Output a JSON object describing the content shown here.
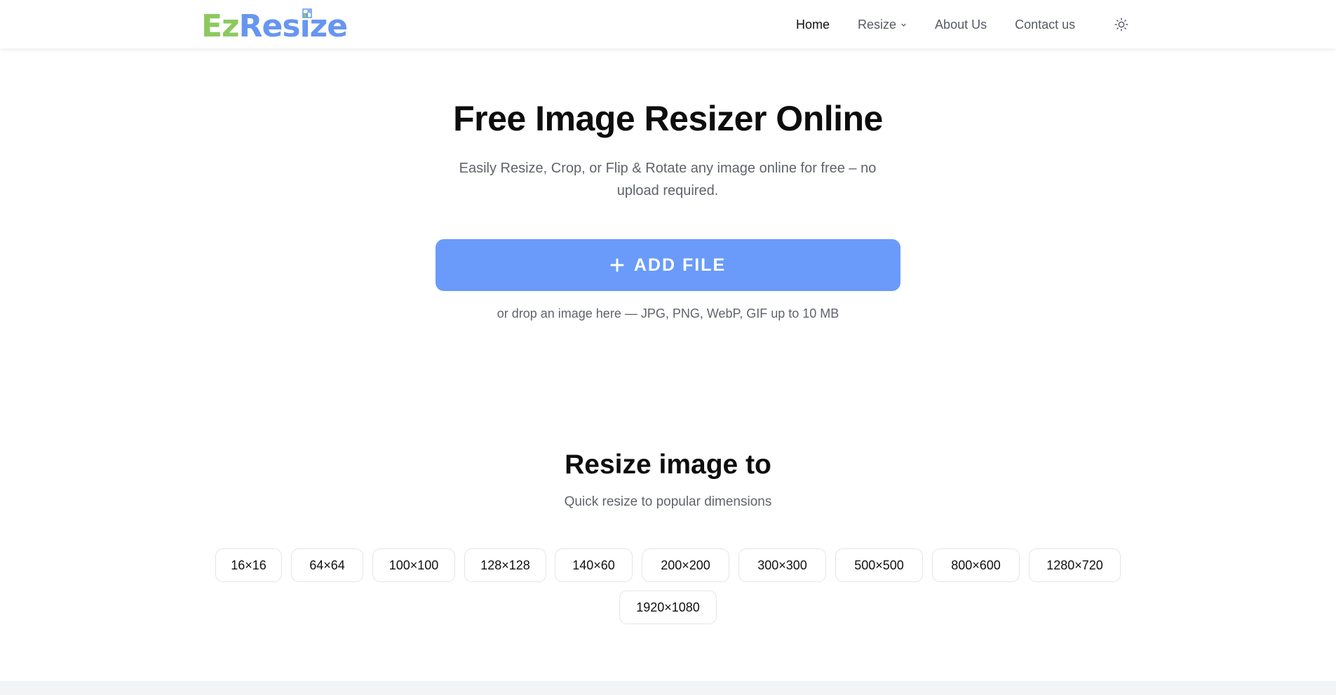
{
  "header": {
    "logo_ez": "Ez",
    "logo_resize": "Resize",
    "nav": {
      "home": "Home",
      "resize": "Resize",
      "about": "About Us",
      "contact": "Contact us"
    },
    "brand_green": "#8dc95f",
    "brand_blue": "#6796f0"
  },
  "hero": {
    "title": "Free Image Resizer Online",
    "subtitle": "Easily Resize, Crop, or Flip & Rotate any image online for free – no upload required.",
    "add_file_label": "ADD FILE",
    "drop_hint": "or drop an image here — JPG, PNG, WebP, GIF up to 10 MB",
    "button_color": "#6a9bfa"
  },
  "resize_section": {
    "title": "Resize image to",
    "subtitle": "Quick resize to popular dimensions",
    "presets": [
      "16×16",
      "64×64",
      "100×100",
      "128×128",
      "140×60",
      "200×200",
      "300×300",
      "500×500",
      "800×600",
      "1280×720",
      "1920×1080"
    ]
  }
}
